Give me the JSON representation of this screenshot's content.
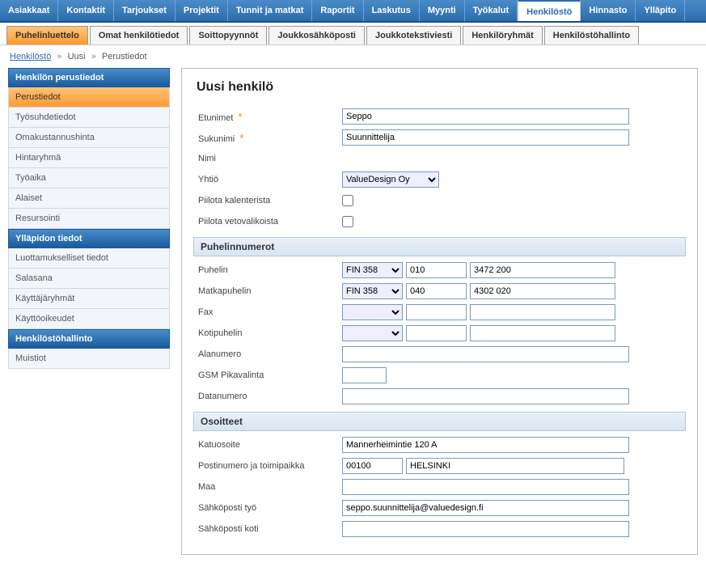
{
  "topnav": {
    "items": [
      "Asiakkaat",
      "Kontaktit",
      "Tarjoukset",
      "Projektit",
      "Tunnit ja matkat",
      "Raportit",
      "Laskutus",
      "Myynti",
      "Työkalut",
      "Henkilöstö",
      "Hinnasto",
      "Ylläpito"
    ],
    "active": 9
  },
  "subnav": {
    "items": [
      "Puhelinluettelo",
      "Omat henkilötiedot",
      "Soittopyynnöt",
      "Joukkosähköposti",
      "Joukkotekstiviesti",
      "Henkilöryhmät",
      "Henkilöstöhallinto"
    ],
    "active": 0
  },
  "breadcrumb": {
    "a": "Henkilöstö",
    "b": "Uusi",
    "c": "Perustiedot"
  },
  "sidebar": {
    "sections": [
      {
        "title": "Henkilön perustiedot",
        "items": [
          "Perustiedot",
          "Työsuhdetiedot",
          "Omakustannushinta",
          "Hintaryhmä",
          "Työaika",
          "Alaiset",
          "Resursointi"
        ],
        "active": 0
      },
      {
        "title": "Ylläpidon tiedot",
        "items": [
          "Luottamukselliset tiedot",
          "Salasana",
          "Käyttäjäryhmät",
          "Käyttöoikeudet"
        ],
        "active": -1
      },
      {
        "title": "Henkilöstöhallinto",
        "items": [
          "Muistiot"
        ],
        "active": -1
      }
    ]
  },
  "form": {
    "title": "Uusi henkilö",
    "labels": {
      "firstname": "Etunimet",
      "lastname": "Sukunimi",
      "name": "Nimi",
      "company": "Yhtiö",
      "hideCal": "Piilota kalenterista",
      "hideDD": "Piilota vetovalikoista",
      "secPhones": "Puhelinnumerot",
      "phone": "Puhelin",
      "mobile": "Matkapuhelin",
      "fax": "Fax",
      "homephone": "Kotipuhelin",
      "ext": "Alanumero",
      "gsm": "GSM Pikavalinta",
      "datanum": "Datanumero",
      "secAddr": "Osoitteet",
      "street": "Katuosoite",
      "postal": "Postinumero ja toimipaikka",
      "country": "Maa",
      "emailWork": "Sähköposti työ",
      "emailHome": "Sähköposti koti"
    },
    "values": {
      "firstname": "Seppo",
      "lastname": "Suunnittelija",
      "company": "ValueDesign Oy",
      "phone_cc": "FIN 358",
      "phone_area": "010",
      "phone_num": "3472 200",
      "mobile_cc": "FIN 358",
      "mobile_area": "040",
      "mobile_num": "4302 020",
      "fax_area": "",
      "fax_num": "",
      "home_area": "",
      "home_num": "",
      "ext": "",
      "gsm": "",
      "datanum": "",
      "street": "Mannerheimintie 120 A",
      "zip": "00100",
      "city": "HELSINKI",
      "country": "",
      "emailWork": "seppo.suunnittelija@valuedesign.fi",
      "emailHome": ""
    }
  }
}
